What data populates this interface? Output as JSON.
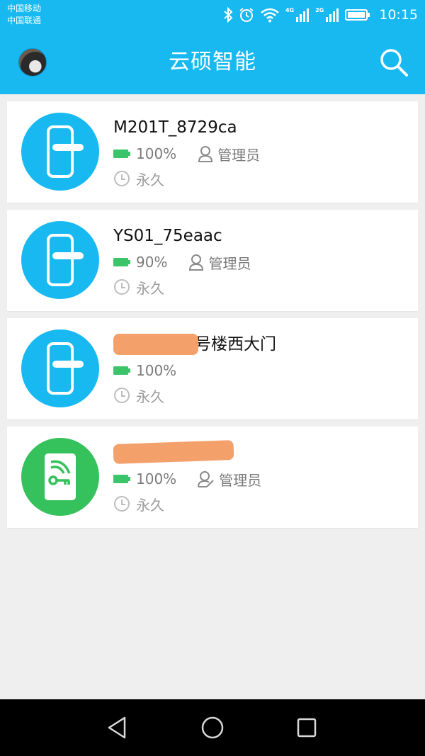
{
  "status_bar": {
    "carrier_1": "中国移动",
    "carrier_2": "中国联通",
    "net_1": "4G",
    "net_2": "2G",
    "time": "10:15",
    "icons": [
      "bluetooth-icon",
      "alarm-icon",
      "wifi-icon",
      "signal-icon",
      "signal-icon",
      "battery-icon"
    ]
  },
  "app_bar": {
    "title": "云硕智能",
    "avatar_icon": "user-avatar",
    "search_icon": "search-icon"
  },
  "locks": [
    {
      "name": "M201T_8729ca",
      "battery": "100%",
      "role": "管理员",
      "validity": "永久",
      "icon": "door-lock-icon",
      "color": "#18b9f1"
    },
    {
      "name": "YS01_75eaac",
      "battery": "90%",
      "role": "管理员",
      "validity": "永久",
      "icon": "door-lock-icon",
      "color": "#18b9f1"
    },
    {
      "name": "号楼西大门",
      "battery": "100%",
      "role": "",
      "validity": "永久",
      "icon": "door-lock-icon",
      "color": "#18b9f1"
    },
    {
      "name": "",
      "battery": "100%",
      "role": "管理员",
      "validity": "永久",
      "icon": "key-card-icon",
      "color": "#35c15c"
    }
  ],
  "nav_bar": {
    "back_icon": "back-triangle-icon",
    "home_icon": "home-circle-icon",
    "recent_icon": "recent-square-icon"
  },
  "colors": {
    "primary": "#18b9f1",
    "battery_green": "#3cc46a",
    "text_secondary": "#7a7a7a",
    "background": "#efefef"
  }
}
